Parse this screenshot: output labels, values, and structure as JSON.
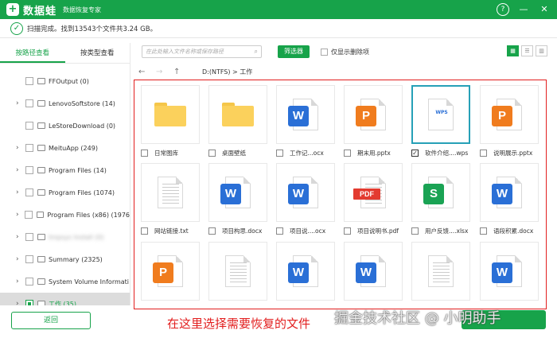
{
  "app": {
    "logo_mark": "+",
    "name": "数据蛙",
    "subtitle": "数据恢复专家",
    "help": "?",
    "minimize": "—",
    "close": "✕"
  },
  "status": {
    "text": "扫描完成。找到13543个文件共3.24 GB。"
  },
  "left_tabs": [
    "按路径查看",
    "按类型查看"
  ],
  "tree": [
    {
      "label": "FFOutput (0)",
      "arrow": false
    },
    {
      "label": "LenovoSoftstore (14)",
      "arrow": true
    },
    {
      "label": "LeStoreDownload (0)",
      "arrow": false
    },
    {
      "label": "MeituApp (249)",
      "arrow": true
    },
    {
      "label": "Program Files (14)",
      "arrow": true
    },
    {
      "label": "Program Files (1074)",
      "arrow": true
    },
    {
      "label": "Program Files (x86) (1976",
      "arrow": true
    },
    {
      "label": "tmpsys Install (0)",
      "arrow": true,
      "blur": true
    },
    {
      "label": "Summary (2325)",
      "arrow": true
    },
    {
      "label": "System Volume Informati",
      "arrow": true
    },
    {
      "label": "工作 (35)",
      "arrow": true,
      "selected": true
    }
  ],
  "back_label": "返回",
  "toolbar": {
    "search_placeholder": "在此处输入文件名称或保存路径",
    "filter_label": "筛选器",
    "only_deleted_label": "仅显示删除项",
    "view_icons": [
      "▦",
      "☰",
      "▥"
    ]
  },
  "path": {
    "back": "←",
    "forward": "→",
    "up": "↑",
    "text": "D:(NTFS) > 工作"
  },
  "files": [
    {
      "name": "日常图库",
      "type": "folder"
    },
    {
      "name": "桌面壁纸",
      "type": "folder"
    },
    {
      "name": "工作记...ocx",
      "type": "word"
    },
    {
      "name": "期末用.pptx",
      "type": "ppt"
    },
    {
      "name": "软件介绍....wps",
      "type": "wps",
      "checked": true,
      "selected": true
    },
    {
      "name": "说明展示.pptx",
      "type": "ppt"
    },
    {
      "name": "网站链接.txt",
      "type": "txt"
    },
    {
      "name": "项目构思.docx",
      "type": "word"
    },
    {
      "name": "项目说....ocx",
      "type": "word"
    },
    {
      "name": "项目说明书.pdf",
      "type": "pdf"
    },
    {
      "name": "用户反馈....xlsx",
      "type": "excel"
    },
    {
      "name": "语段积累.docx",
      "type": "word"
    },
    {
      "name": "",
      "type": "ppt"
    },
    {
      "name": "",
      "type": "txt"
    },
    {
      "name": "",
      "type": "word"
    },
    {
      "name": "",
      "type": "word"
    },
    {
      "name": "",
      "type": "txt"
    },
    {
      "name": "",
      "type": "word"
    }
  ],
  "badges": {
    "word": "W",
    "ppt": "P",
    "excel": "S",
    "pdf": "PDF",
    "wps": "WPS"
  },
  "annotation": "在这里选择需要恢复的文件",
  "watermark": "掘金技术社区 @ 小明助手",
  "colors": {
    "brand": "#17a34a",
    "highlight_box": "#e21e1e",
    "selected_card": "#26a0b7"
  }
}
